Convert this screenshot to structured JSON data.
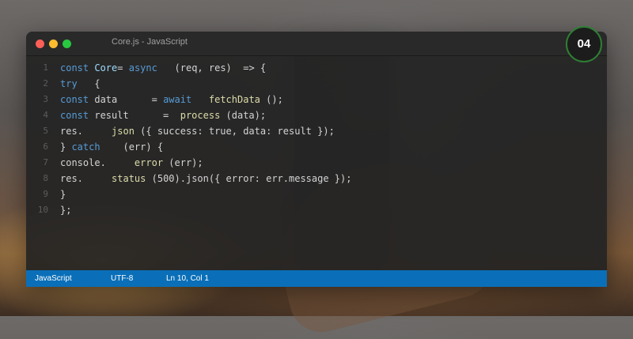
{
  "window": {
    "title": "Core.js - JavaScript"
  },
  "badge": "04",
  "code": [
    {
      "n": "1",
      "tokens": [
        {
          "t": "const ",
          "c": "kw"
        },
        {
          "t": "Core",
          "c": "cls"
        },
        {
          "t": "= ",
          "c": ""
        },
        {
          "t": "async",
          "c": "kw"
        },
        {
          "t": "   (req, res)  => {",
          "c": ""
        }
      ]
    },
    {
      "n": "2",
      "tokens": [
        {
          "t": "try",
          "c": "kw"
        },
        {
          "t": "   {",
          "c": ""
        }
      ]
    },
    {
      "n": "3",
      "tokens": [
        {
          "t": "const ",
          "c": "kw"
        },
        {
          "t": "data      = ",
          "c": ""
        },
        {
          "t": "await",
          "c": "kw"
        },
        {
          "t": "   ",
          "c": ""
        },
        {
          "t": "fetchData",
          "c": "fn"
        },
        {
          "t": " ();",
          "c": ""
        }
      ]
    },
    {
      "n": "4",
      "tokens": [
        {
          "t": "const ",
          "c": "kw"
        },
        {
          "t": "result      =  ",
          "c": ""
        },
        {
          "t": "process",
          "c": "fn"
        },
        {
          "t": " (data);",
          "c": ""
        }
      ]
    },
    {
      "n": "5",
      "tokens": [
        {
          "t": "res.     ",
          "c": ""
        },
        {
          "t": "json",
          "c": "fn"
        },
        {
          "t": " ({ success: true, data: result });",
          "c": ""
        }
      ]
    },
    {
      "n": "6",
      "tokens": [
        {
          "t": "} ",
          "c": ""
        },
        {
          "t": "catch",
          "c": "kw"
        },
        {
          "t": "    (err) {",
          "c": ""
        }
      ]
    },
    {
      "n": "7",
      "tokens": [
        {
          "t": "console.     ",
          "c": ""
        },
        {
          "t": "error",
          "c": "fn"
        },
        {
          "t": " (err);",
          "c": ""
        }
      ]
    },
    {
      "n": "8",
      "tokens": [
        {
          "t": "res.     ",
          "c": ""
        },
        {
          "t": "status",
          "c": "fn"
        },
        {
          "t": " (500).json({ error: err.message });",
          "c": ""
        }
      ]
    },
    {
      "n": "9",
      "tokens": [
        {
          "t": "}",
          "c": ""
        }
      ]
    },
    {
      "n": "10",
      "tokens": [
        {
          "t": "};",
          "c": ""
        }
      ]
    }
  ],
  "status": {
    "language": "JavaScript",
    "encoding": "UTF-8",
    "position": "Ln 10, Col 1",
    "color": "#0a6fb8"
  },
  "colors": {
    "keyword": "#569cd6",
    "function": "#dcdcaa",
    "identifier": "#9cdcfe",
    "text": "#d4d4d4"
  }
}
